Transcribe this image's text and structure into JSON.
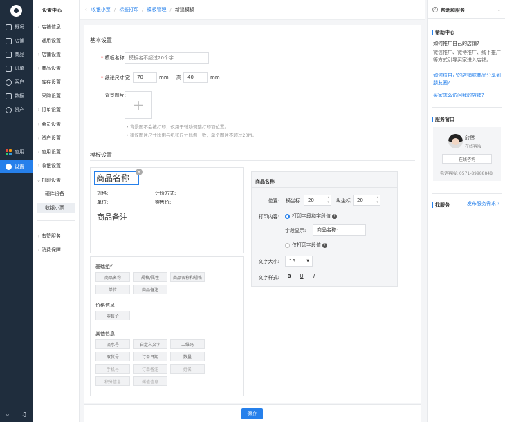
{
  "nav": {
    "items": [
      {
        "label": "概况",
        "icon": "overview-icon"
      },
      {
        "label": "店铺",
        "icon": "store-icon"
      },
      {
        "label": "商品",
        "icon": "tag-icon"
      },
      {
        "label": "订单",
        "icon": "order-icon"
      },
      {
        "label": "客户",
        "icon": "user-icon"
      },
      {
        "label": "数据",
        "icon": "chart-icon"
      },
      {
        "label": "资产",
        "icon": "asset-icon"
      }
    ],
    "apps_label": "应用",
    "settings_label": "设置",
    "accent": "#2680eb",
    "bg": "#1f2d3d"
  },
  "subnav": {
    "title": "设置中心",
    "items": [
      "店铺信息",
      "通用设置",
      "店铺设置",
      "商品设置",
      "库存设置",
      "采购设置",
      "订单设置",
      "会员设置",
      "资产设置",
      "应用设置",
      "收银设置",
      "打印设置"
    ],
    "children": [
      "硬件设备",
      "收银小票"
    ],
    "bottom": [
      "有赞服务",
      "消费保障"
    ]
  },
  "breadcrumb": [
    "收银小票",
    "标签打印",
    "模板管理",
    "新建模板"
  ],
  "basic": {
    "title": "基本设置",
    "name_label": "模板名称:",
    "name_placeholder": "模板名不超过20个字",
    "size_label": "纸张尺寸:",
    "width_label": "宽",
    "width_value": "70",
    "height_label": "高",
    "height_value": "40",
    "unit": "mm",
    "bg_label": "背景图片:",
    "hints": [
      "背景图不会被打印，仅用于辅助调整打印项位置。",
      "建议图片尺寸比例与纸张尺寸比例一致，单个图片不超过20M。"
    ]
  },
  "template": {
    "title": "模板设置",
    "product_name": "商品名称",
    "spec": "规格:",
    "pricing": "计价方式:",
    "unit": "单位:",
    "retail": "零售价:",
    "note": "商品备注",
    "groups": [
      {
        "title": "基础组件",
        "chips": [
          "商品名称",
          "规格/属性",
          "商品名称和规格",
          "单位",
          "商品备注"
        ]
      },
      {
        "title": "价格信息",
        "chips": [
          "零售价"
        ]
      },
      {
        "title": "其他信息",
        "chips": [
          "流水号",
          "自定义文字",
          "二维码",
          "取货号",
          "订单日期",
          "数量",
          "手机号",
          "订单备注",
          "姓名",
          "积分信息",
          "储值信息"
        ]
      }
    ]
  },
  "props": {
    "title": "商品名称",
    "position_label": "位置:",
    "x_label": "横坐标",
    "x_value": "20",
    "y_label": "纵坐标",
    "y_value": "20",
    "content_label": "打印内容:",
    "opt_field_value": "打印字段和字段值",
    "field_display_label": "字段显示:",
    "field_display_value": "商品名称:",
    "opt_value_only": "仅打印字段值",
    "size_label": "文字大小:",
    "size_value": "16",
    "style_label": "文字样式:",
    "styles": [
      "B",
      "U",
      "I"
    ]
  },
  "save_label": "保存",
  "help": {
    "title": "帮助和服务",
    "center_title": "帮助中心",
    "q1": "如何推广自己的店铺?",
    "a1": "微信推广、微博推广、线下推广等方式引导买家进入店铺。",
    "link1": "如何将自己的店铺或商品分享到朋友圈?",
    "link2": "买家怎么访问我的店铺?",
    "window_title": "服务窗口",
    "agent_name": "欣然",
    "agent_role": "在线客服",
    "consult": "在线咨询",
    "phone": "电话客服: 0571-89988848",
    "find_title": "找服务",
    "find_link": "发布服务需求"
  }
}
